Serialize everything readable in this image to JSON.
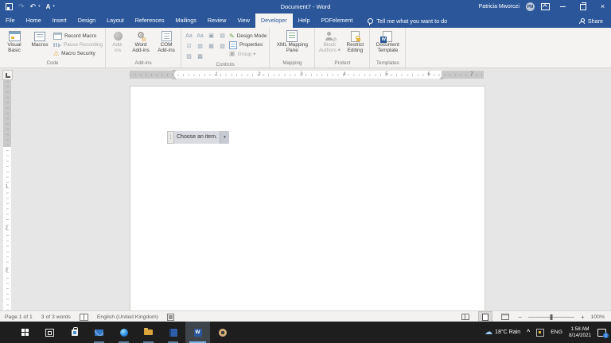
{
  "titlebar": {
    "title": "Document7 - Word",
    "user": "Patricia Mworozi",
    "avatar": "PM"
  },
  "tabs": [
    {
      "label": "File"
    },
    {
      "label": "Home"
    },
    {
      "label": "Insert"
    },
    {
      "label": "Design"
    },
    {
      "label": "Layout"
    },
    {
      "label": "References"
    },
    {
      "label": "Mailings"
    },
    {
      "label": "Review"
    },
    {
      "label": "View"
    },
    {
      "label": "Developer"
    },
    {
      "label": "Help"
    },
    {
      "label": "PDFelement"
    }
  ],
  "tellme": "Tell me what you want to do",
  "share": "Share",
  "ribbon": {
    "code": {
      "label": "Code",
      "visual_basic": "Visual\nBasic",
      "macros": "Macros",
      "record_macro": "Record Macro",
      "pause_recording": "Pause Recording",
      "macro_security": "Macro Security"
    },
    "addins": {
      "label": "Add-ins",
      "addins": "Add-\nins",
      "word_addins": "Word\nAdd-ins",
      "com_addins": "COM\nAdd-ins"
    },
    "controls": {
      "label": "Controls",
      "design_mode": "Design Mode",
      "properties": "Properties",
      "group": "Group ▾"
    },
    "mapping": {
      "label": "Mapping",
      "xml_mapping_pane": "XML Mapping\nPane"
    },
    "protect": {
      "label": "Protect",
      "block_authors": "Block\nAuthors ▾",
      "restrict_editing": "Restrict\nEditing"
    },
    "templates": {
      "label": "Templates",
      "document_template": "Document\nTemplate"
    }
  },
  "icons": {
    "undo": "↶",
    "redo": "↷",
    "dropdown": "▾",
    "close": "×",
    "read_aloud": "A",
    "rich_text": "Aa",
    "plain_text": "Aa",
    "picture": "▣",
    "building_block": "▤",
    "checkbox": "☑",
    "combo_box": "▥",
    "dropdown_list": "▦",
    "date_picker": "▧",
    "repeating_section": "▨",
    "legacy_tools": "▩",
    "gear": "⚙",
    "warning": "⚠",
    "slash": "⊘",
    "pencil": "✎",
    "dots": "⋮",
    "minus": "−",
    "plus": "+",
    "word_letter": "W",
    "cloud": "☁",
    "chevron_up": "^"
  },
  "ruler": {
    "h": [
      "1",
      "2",
      "3",
      "4",
      "5",
      "6",
      "7"
    ],
    "v": [
      "1",
      "2",
      "3"
    ]
  },
  "document": {
    "dropdown_text": "Choose an item."
  },
  "status": {
    "page": "Page 1 of 1",
    "words": "3 of 3 words",
    "language": "English (United Kingdom)",
    "zoom": "100%"
  },
  "taskbar": {
    "weather": "18°C Rain",
    "lang": "ENG",
    "time": "1:58 AM",
    "date": "8/14/2021",
    "badge": "2"
  }
}
